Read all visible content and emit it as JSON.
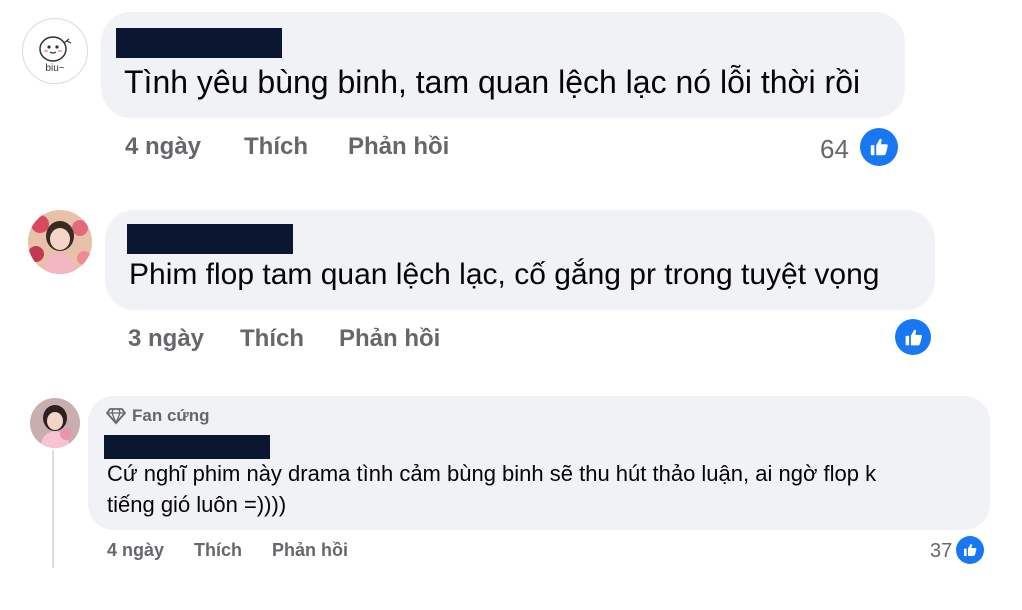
{
  "comments": [
    {
      "avatar_label": "biu~",
      "text": "Tình yêu bùng binh, tam quan lệch lạc nó lỗi thời rồi",
      "time": "4 ngày",
      "like_label": "Thích",
      "reply_label": "Phản hồi",
      "reaction_count": "64"
    },
    {
      "text": "Phim flop tam quan lệch lạc, cố gắng pr trong tuyệt vọng",
      "time": "3 ngày",
      "like_label": "Thích",
      "reply_label": "Phản hồi",
      "reaction_count": ""
    },
    {
      "badge": "Fan cứng",
      "text_line1": "Cứ nghĩ phim này drama tình cảm bùng binh sẽ thu hút thảo luận, ai ngờ flop k",
      "text_line2": "tiếng gió luôn =))))",
      "time": "4 ngày",
      "like_label": "Thích",
      "reply_label": "Phản hồi",
      "reaction_count": "37"
    }
  ],
  "colors": {
    "bubble": "#f0f2f5",
    "meta_text": "#65676b",
    "like_blue": "#1877f2",
    "redaction": "#0b1630"
  },
  "icons": [
    "avatar-biu",
    "avatar-girl-flowers",
    "avatar-girl-pink",
    "thumbs-up-icon",
    "diamond-icon"
  ]
}
